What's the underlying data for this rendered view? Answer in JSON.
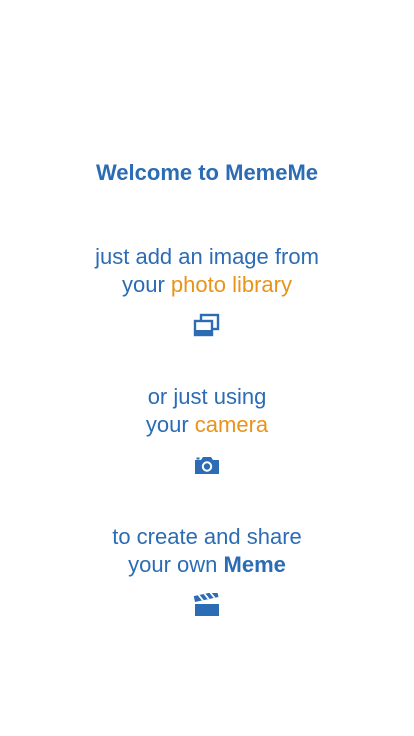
{
  "colors": {
    "primary": "#2b6cb4",
    "accent": "#e8931a",
    "background": "#ffffff"
  },
  "title": "Welcome to MemeMe",
  "library_section": {
    "line1": "just add an image from",
    "line2_prefix": "your ",
    "line2_highlight": "photo library",
    "icon": "photo-library-icon"
  },
  "camera_section": {
    "line1": "or just using",
    "line2_prefix": "your ",
    "line2_highlight": "camera",
    "icon": "camera-icon"
  },
  "meme_section": {
    "line1": "to create and share",
    "line2_prefix": "your own ",
    "line2_highlight": "Meme",
    "icon": "clapperboard-icon"
  }
}
